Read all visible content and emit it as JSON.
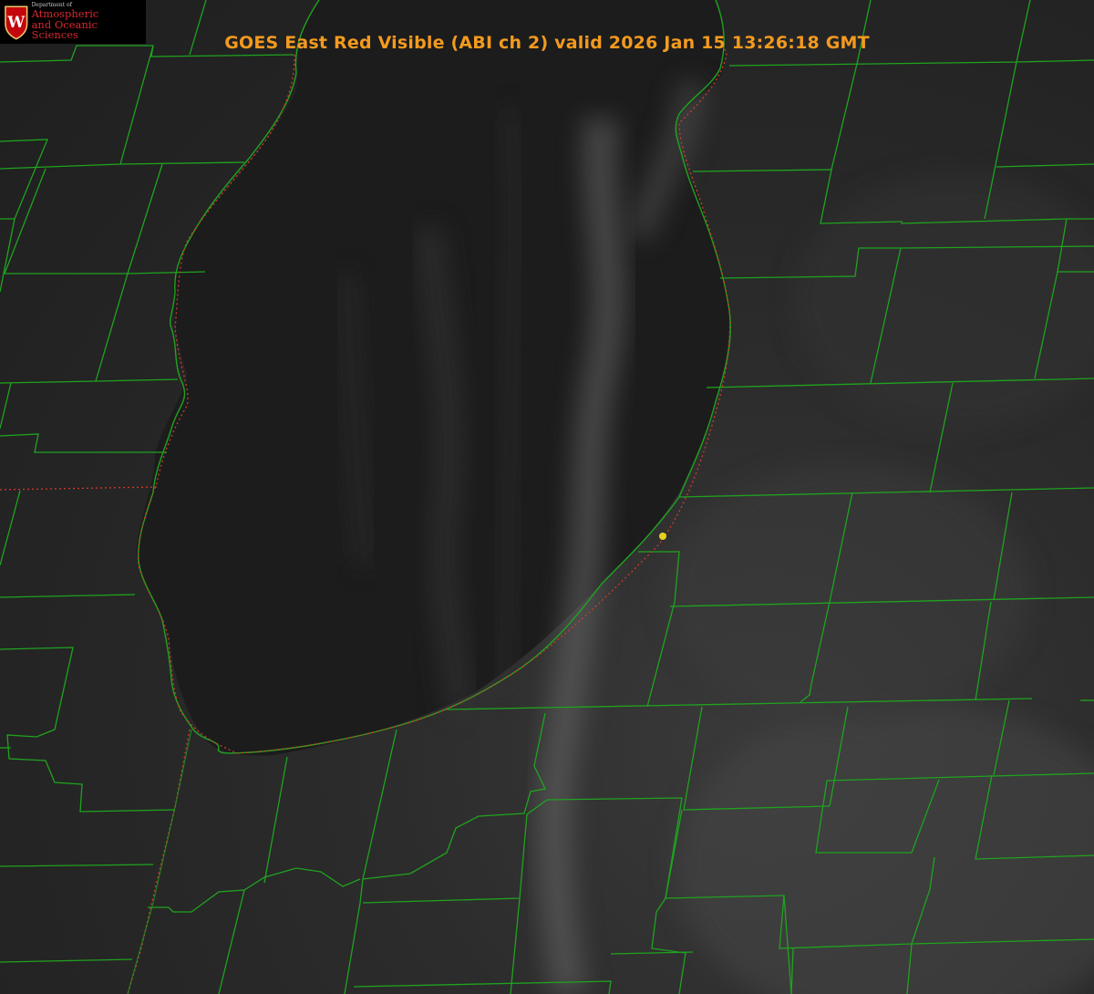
{
  "header": {
    "title": "GOES East Red Visible (ABI ch 2) valid 2026 Jan 15 13:26:18 GMT"
  },
  "logo": {
    "department": "Department of",
    "line1": "Atmospheric",
    "line2": "and Oceanic Sciences",
    "crest_letter": "W"
  },
  "colors": {
    "county_lines": "#1fa31f",
    "state_line": "#d23a2a",
    "title": "#f39a1e",
    "logo_text": "#d8282f",
    "marker": "#e6d21e"
  },
  "map": {
    "layers": [
      "visible-satellite-image",
      "county-boundaries",
      "state-boundary",
      "shoreline",
      "location-marker"
    ]
  }
}
